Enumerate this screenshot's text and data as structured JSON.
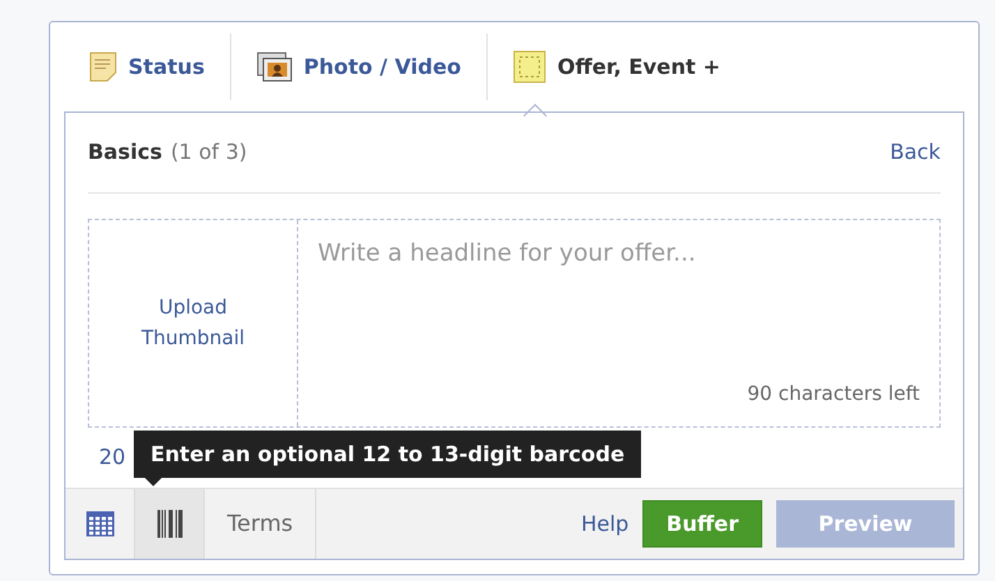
{
  "tabs": [
    {
      "label": "Status",
      "kind": "status",
      "selected": false
    },
    {
      "label": "Photo / Video",
      "kind": "photo",
      "selected": false
    },
    {
      "label": "Offer, Event +",
      "kind": "offer",
      "selected": true
    }
  ],
  "panel": {
    "title": "Basics",
    "step": "(1 of 3)",
    "back": "Back"
  },
  "thumbnail": {
    "label": "Upload Thumbnail"
  },
  "headline": {
    "placeholder": "Write a headline for your offer...",
    "counter": "90 characters left"
  },
  "partial_text": "20",
  "tooltip": "Enter an optional 12 to 13-digit barcode",
  "tools": [
    {
      "kind": "calendar",
      "selected": false
    },
    {
      "kind": "barcode",
      "selected": true
    },
    {
      "kind": "text",
      "label": "Terms",
      "selected": false
    }
  ],
  "actions": {
    "help": "Help",
    "buffer": "Buffer",
    "preview": "Preview"
  }
}
